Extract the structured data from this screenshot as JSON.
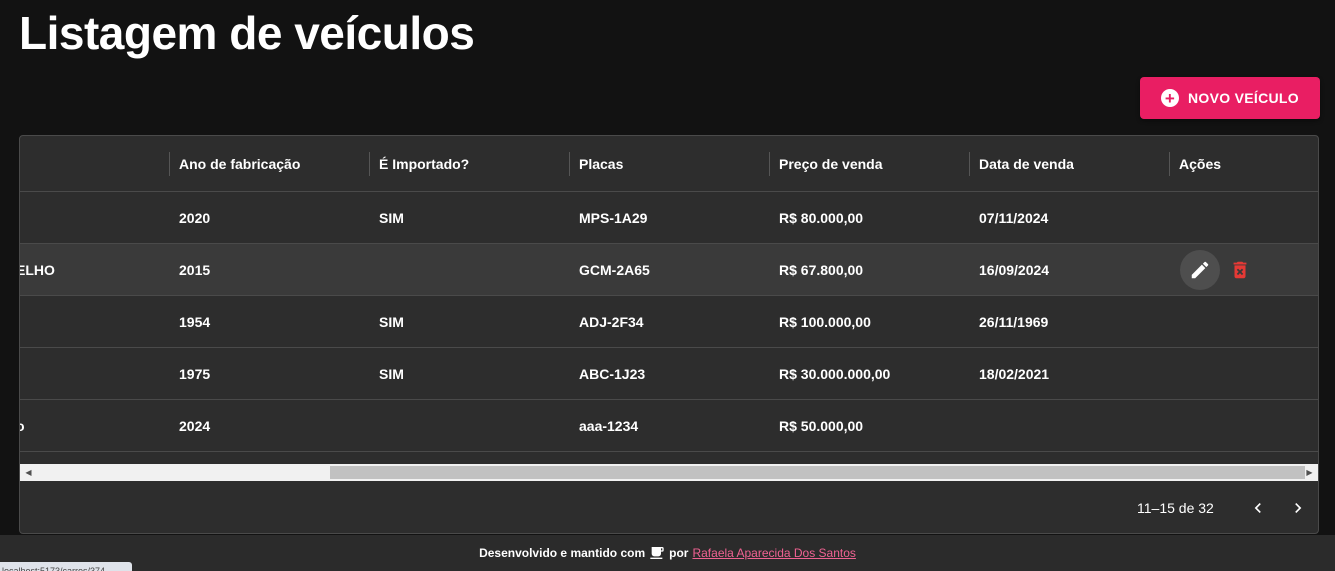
{
  "page": {
    "title": "Listagem de veículos"
  },
  "toolbar": {
    "new_label": "NOVO VEÍCULO",
    "new_icon": "add-circle-icon"
  },
  "table": {
    "columns": [
      "",
      "Ano de fabricação",
      "É Importado?",
      "Placas",
      "Preço de venda",
      "Data de venda",
      "Ações"
    ],
    "rows": [
      {
        "model": "",
        "year": "2020",
        "imported": "SIM",
        "plate": "MPS-1A29",
        "price": "R$ 80.000,00",
        "sale_date": "07/11/2024"
      },
      {
        "model": "ELHO",
        "year": "2015",
        "imported": "",
        "plate": "GCM-2A65",
        "price": "R$ 67.800,00",
        "sale_date": "16/09/2024"
      },
      {
        "model": "",
        "year": "1954",
        "imported": "SIM",
        "plate": "ADJ-2F34",
        "price": "R$ 100.000,00",
        "sale_date": "26/11/1969"
      },
      {
        "model": "",
        "year": "1975",
        "imported": "SIM",
        "plate": "ABC-1J23",
        "price": "R$ 30.000.000,00",
        "sale_date": "18/02/2021"
      },
      {
        "model": "o",
        "year": "2024",
        "imported": "",
        "plate": "aaa-1234",
        "price": "R$ 50.000,00",
        "sale_date": ""
      }
    ],
    "hovered_row_index": 1,
    "actions": {
      "edit_icon": "pencil-icon",
      "delete_icon": "trash-icon"
    }
  },
  "pagination": {
    "range_text": "11–15 de 32"
  },
  "footer": {
    "text": "Desenvolvido e mantido com",
    "icon": "coffee-cup-icon",
    "by": "por",
    "author_link": "Rafaela Aparecida Dos Santos"
  },
  "status_bar": {
    "url": "localhost:5173/carros/374"
  },
  "colors": {
    "accent": "#e91e63",
    "background": "#121212",
    "surface": "#2d2d2d",
    "delete": "#e53935",
    "link": "#f06292"
  }
}
